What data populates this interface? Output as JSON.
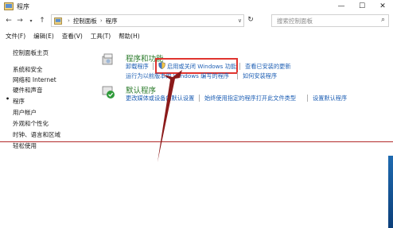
{
  "window": {
    "title": "程序",
    "controls": {
      "minimize": "—",
      "maximize": "☐",
      "close": "✕"
    }
  },
  "nav": {
    "back": "←",
    "forward": "→",
    "up": "↑",
    "breadcrumb": [
      "控制面板",
      "程序"
    ],
    "search_placeholder": "搜索控制面板"
  },
  "menu": {
    "items": [
      "文件(F)",
      "编辑(E)",
      "查看(V)",
      "工具(T)",
      "帮助(H)"
    ]
  },
  "sidebar": {
    "items": [
      "控制面板主页",
      "系统和安全",
      "网络和 Internet",
      "硬件和声音",
      "程序",
      "用户帐户",
      "外观和个性化",
      "时钟、语言和区域",
      "轻松使用"
    ],
    "current_index": 4
  },
  "main": {
    "programs": {
      "heading": "程序和功能",
      "links": [
        "卸载程序",
        "启用或关闭 Windows 功能",
        "查看已安装的更新",
        "运行为以前版本的 Windows 编写的程序",
        "如何安装程序"
      ]
    },
    "defaults": {
      "heading": "默认程序",
      "links": [
        "更改媒体或设备的默认设置",
        "始终使用指定的程序打开此文件类型",
        "设置默认程序"
      ]
    }
  },
  "colors": {
    "highlight": "#e0342f",
    "link": "#1e5fb4",
    "heading": "#2a7a2a",
    "arrow": "#8b1a1a"
  }
}
